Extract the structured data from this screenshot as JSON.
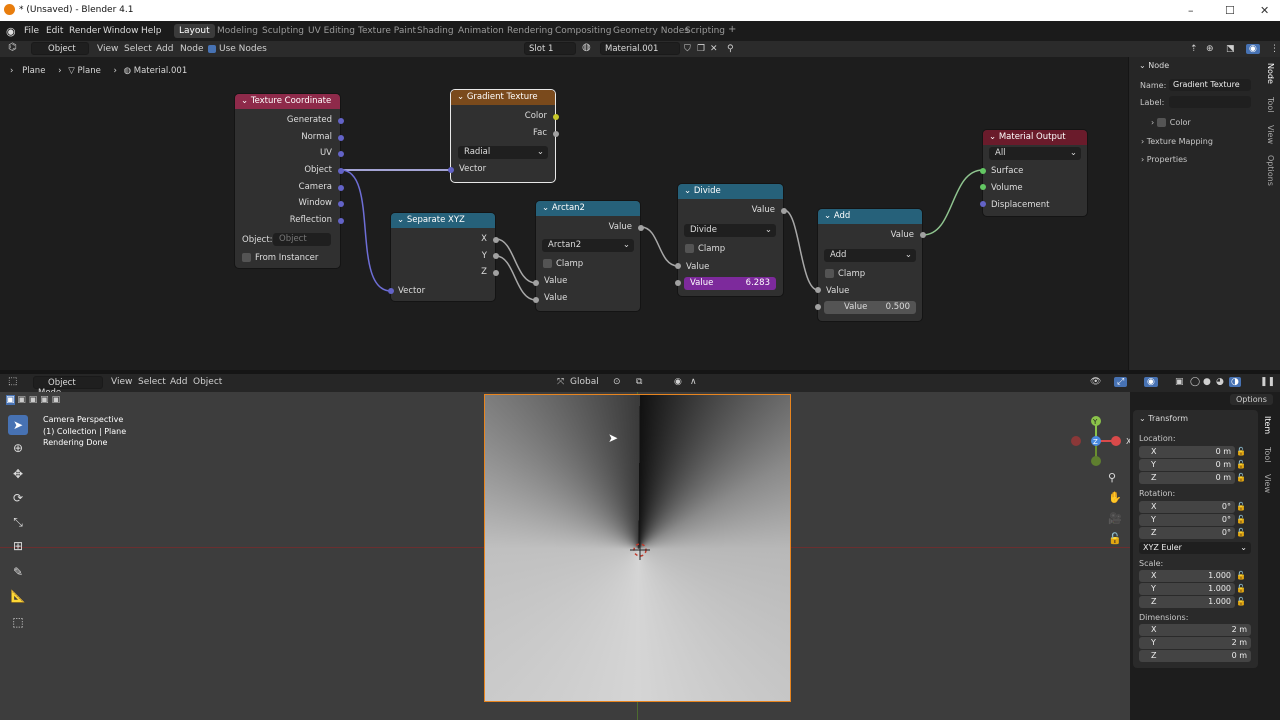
{
  "window": {
    "title": "* (Unsaved) - Blender 4.1"
  },
  "menu": [
    "File",
    "Edit",
    "Render",
    "Window",
    "Help"
  ],
  "workspaces": [
    "Layout",
    "Modeling",
    "Sculpting",
    "UV Editing",
    "Texture Paint",
    "Shading",
    "Animation",
    "Rendering",
    "Compositing",
    "Geometry Nodes",
    "Scripting",
    "+"
  ],
  "node_header": {
    "object_dd": "Object",
    "view": "View",
    "select": "Select",
    "add": "Add",
    "node": "Node",
    "use_nodes": "Use Nodes",
    "slot": "Slot 1",
    "material": "Material.001"
  },
  "breadcrumb": {
    "a": "Plane",
    "b": "Plane",
    "c": "Material.001"
  },
  "nodes": {
    "texcoord": {
      "title": "Texture Coordinate",
      "outs": [
        "Generated",
        "Normal",
        "UV",
        "Object",
        "Camera",
        "Window",
        "Reflection"
      ],
      "object_label": "Object:",
      "object_ph": "Object",
      "from_instancer": "From Instancer"
    },
    "gradient": {
      "title": "Gradient Texture",
      "color": "Color",
      "fac": "Fac",
      "type": "Radial",
      "vector": "Vector"
    },
    "sepxyz": {
      "title": "Separate XYZ",
      "x": "X",
      "y": "Y",
      "z": "Z",
      "vector": "Vector"
    },
    "arctan": {
      "title": "Arctan2",
      "value": "Value",
      "op": "Arctan2",
      "clamp": "Clamp",
      "in1": "Value",
      "in2": "Value"
    },
    "divide": {
      "title": "Divide",
      "value": "Value",
      "op": "Divide",
      "clamp": "Clamp",
      "in1": "Value",
      "in2_label": "Value",
      "in2_val": "6.283"
    },
    "add": {
      "title": "Add",
      "value": "Value",
      "op": "Add",
      "clamp": "Clamp",
      "in1": "Value",
      "in2_label": "Value",
      "in2_val": "0.500"
    },
    "output": {
      "title": "Material Output",
      "target": "All",
      "surface": "Surface",
      "volume": "Volume",
      "displacement": "Displacement"
    }
  },
  "sidebar": {
    "section": "Node",
    "name_label": "Name:",
    "name_val": "Gradient Texture",
    "label_label": "Label:",
    "color": "Color",
    "texmap": "Texture Mapping",
    "properties": "Properties",
    "tabs": [
      "Node",
      "Tool",
      "View",
      "Options"
    ]
  },
  "vp_header": {
    "mode": "Object Mode",
    "view": "View",
    "select": "Select",
    "add": "Add",
    "object": "Object",
    "orient": "Global",
    "options": "Options"
  },
  "viewport_text": {
    "l1": "Camera Perspective",
    "l2": "(1) Collection | Plane",
    "l3": "Rendering Done"
  },
  "gizmo": {
    "x": "X",
    "y": "Y",
    "z": "Z"
  },
  "transform": {
    "title": "Transform",
    "location": "Location:",
    "rotation": "Rotation:",
    "scale": "Scale:",
    "dimensions": "Dimensions:",
    "loc": [
      [
        "X",
        "0 m"
      ],
      [
        "Y",
        "0 m"
      ],
      [
        "Z",
        "0 m"
      ]
    ],
    "rot": [
      [
        "X",
        "0°"
      ],
      [
        "Y",
        "0°"
      ],
      [
        "Z",
        "0°"
      ]
    ],
    "euler": "XYZ Euler",
    "scl": [
      [
        "X",
        "1.000"
      ],
      [
        "Y",
        "1.000"
      ],
      [
        "Z",
        "1.000"
      ]
    ],
    "dim": [
      [
        "X",
        "2 m"
      ],
      [
        "Y",
        "2 m"
      ],
      [
        "Z",
        "0 m"
      ]
    ],
    "tabs": [
      "Item",
      "Tool",
      "View"
    ]
  },
  "colors": {
    "texcoord": "#8e2a4a",
    "gradient": "#7a4a1c",
    "converter": "#26617a",
    "output": "#6a1b2b",
    "vector_socket": "#6363c7",
    "float_socket": "#a1a1a1",
    "color_socket": "#c7c729",
    "shader_socket": "#63c763"
  }
}
